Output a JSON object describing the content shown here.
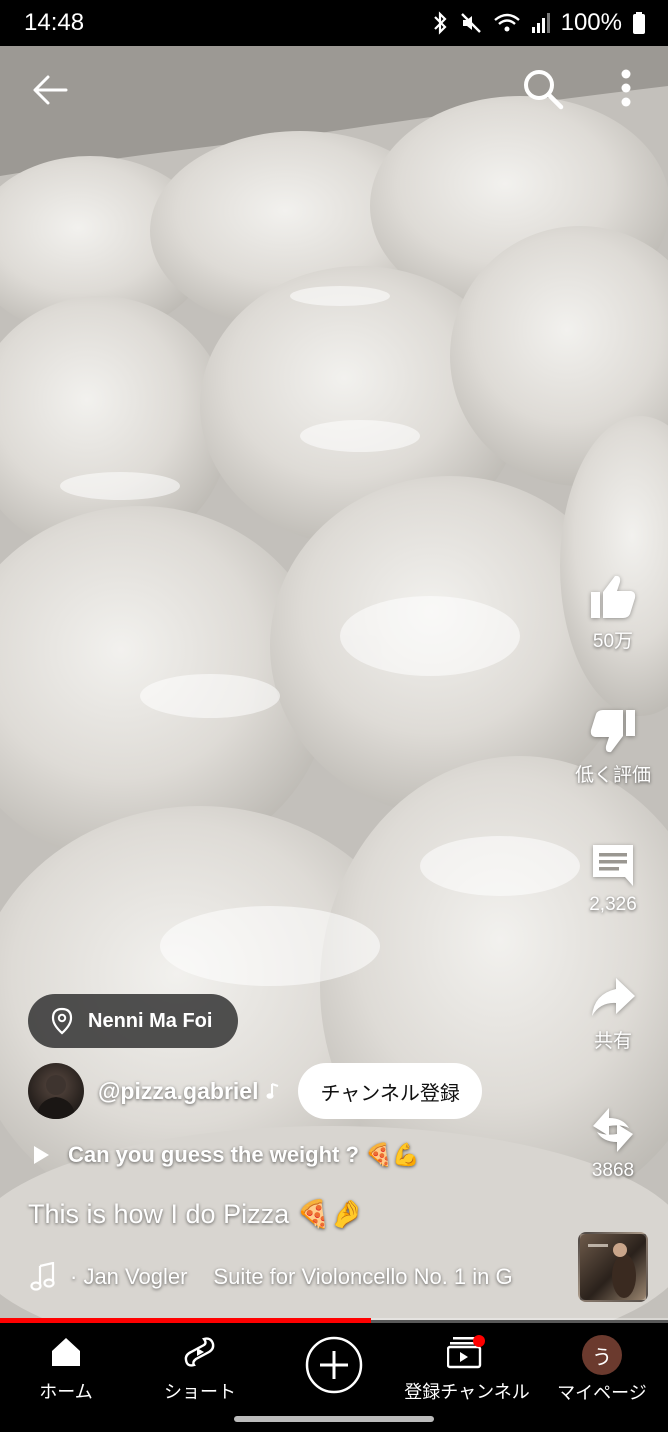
{
  "status_bar": {
    "time": "14:48",
    "battery": "100%",
    "icons": [
      "bluetooth-icon",
      "mute-icon",
      "wifi-icon",
      "signal-icon",
      "battery-icon"
    ]
  },
  "top_bar": {
    "icons": [
      "back-arrow-icon",
      "search-icon",
      "more-vert-icon"
    ]
  },
  "actions": {
    "like_count": "50万",
    "dislike_label": "低く評価",
    "comment_count": "2,326",
    "share_label": "共有",
    "remix_count": "3868"
  },
  "location": {
    "name": "Nenni Ma Foi",
    "icon": "location-pin-icon"
  },
  "channel": {
    "handle": "@pizza.gabriel",
    "subscribe_label": "チャンネル登録"
  },
  "playlist": {
    "title": "Can you guess the weight ? 🍕💪"
  },
  "caption": "This is how I do Pizza 🍕🤌",
  "music": {
    "artist": "· Jan Vogler",
    "track": "Suite for Violoncello No. 1 in G"
  },
  "progress": {
    "fraction": 0.555,
    "color": "#ff0000"
  },
  "bottom_nav": {
    "home": "ホーム",
    "shorts": "ショート",
    "subscriptions": "登録チャンネル",
    "mypage": "マイページ",
    "avatar_letter": "う"
  },
  "colors": {
    "accent": "#ff0000",
    "avatar_bg": "#6b3a2e"
  }
}
